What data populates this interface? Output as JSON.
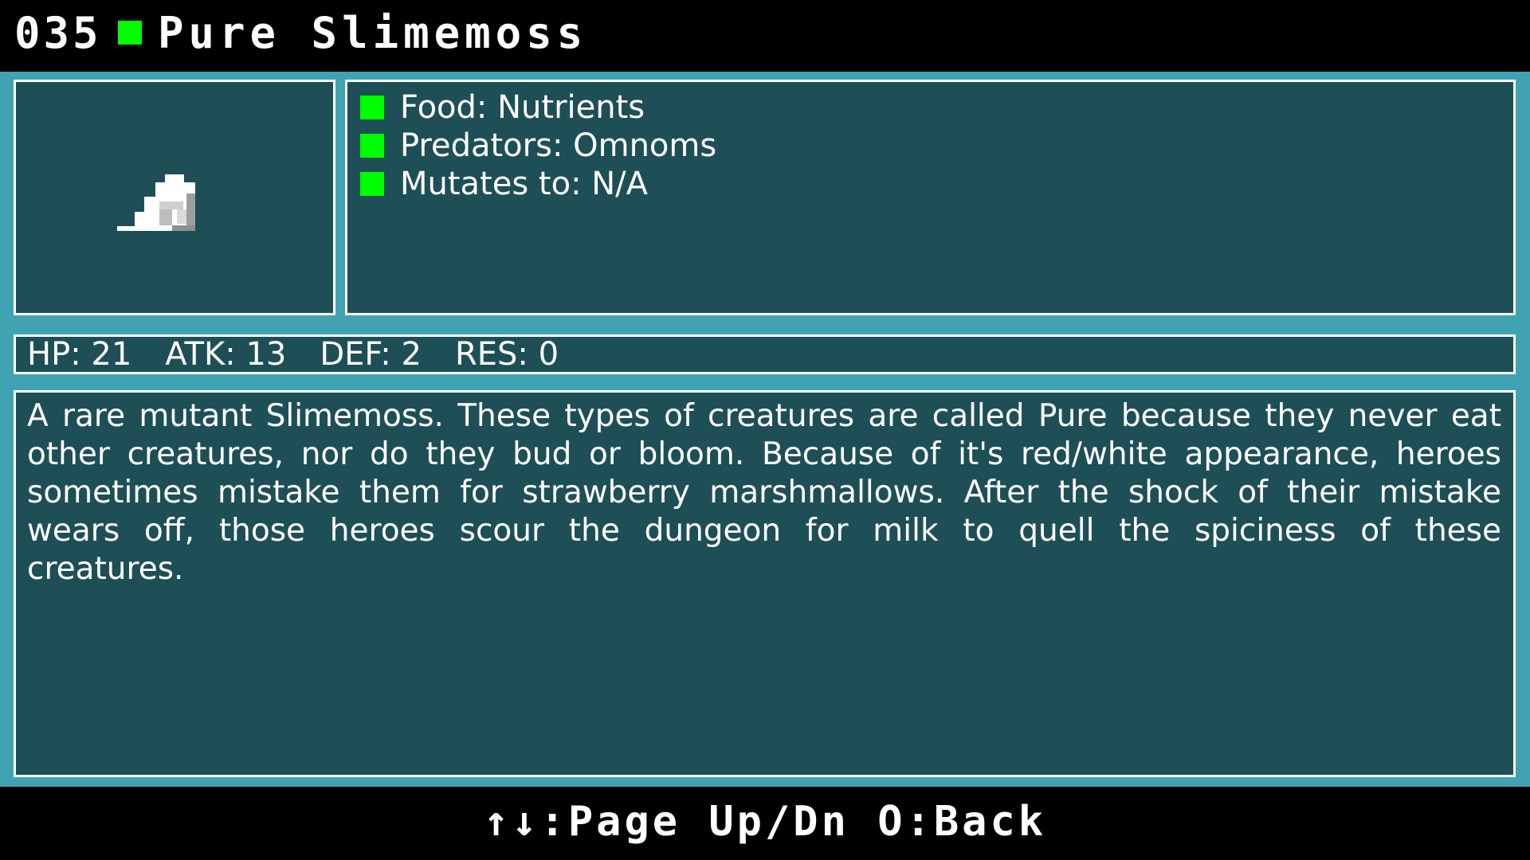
{
  "header": {
    "number": "035",
    "name": "Pure Slimemoss",
    "marker_color": "#00ff00"
  },
  "portrait": {
    "icon": "slimemoss-creature-sprite"
  },
  "info": {
    "rows": [
      {
        "label": "Food: Nutrients"
      },
      {
        "label": "Predators: Omnoms"
      },
      {
        "label": "Mutates to: N/A"
      }
    ],
    "bullet_color": "#00ff00"
  },
  "stats": {
    "hp": "HP: 21",
    "atk": "ATK: 13",
    "def": "DEF: 2",
    "res": "RES: 0"
  },
  "description": {
    "text": "A rare mutant Slimemoss. These types of creatures are called Pure because they never eat other creatures, nor do they bud or bloom. Because of it's red/white appearance, heroes sometimes mistake them for strawberry marshmallows. After the shock of their mistake wears off, those heroes scour the dungeon for milk to quell the spiciness of these creatures."
  },
  "footer": {
    "hint": "↑↓:Page Up/Dn O:Back"
  },
  "colors": {
    "panel_bg": "#1e4f57",
    "frame": "#3fa3b2",
    "border": "#ffffff",
    "accent": "#00ff00"
  }
}
